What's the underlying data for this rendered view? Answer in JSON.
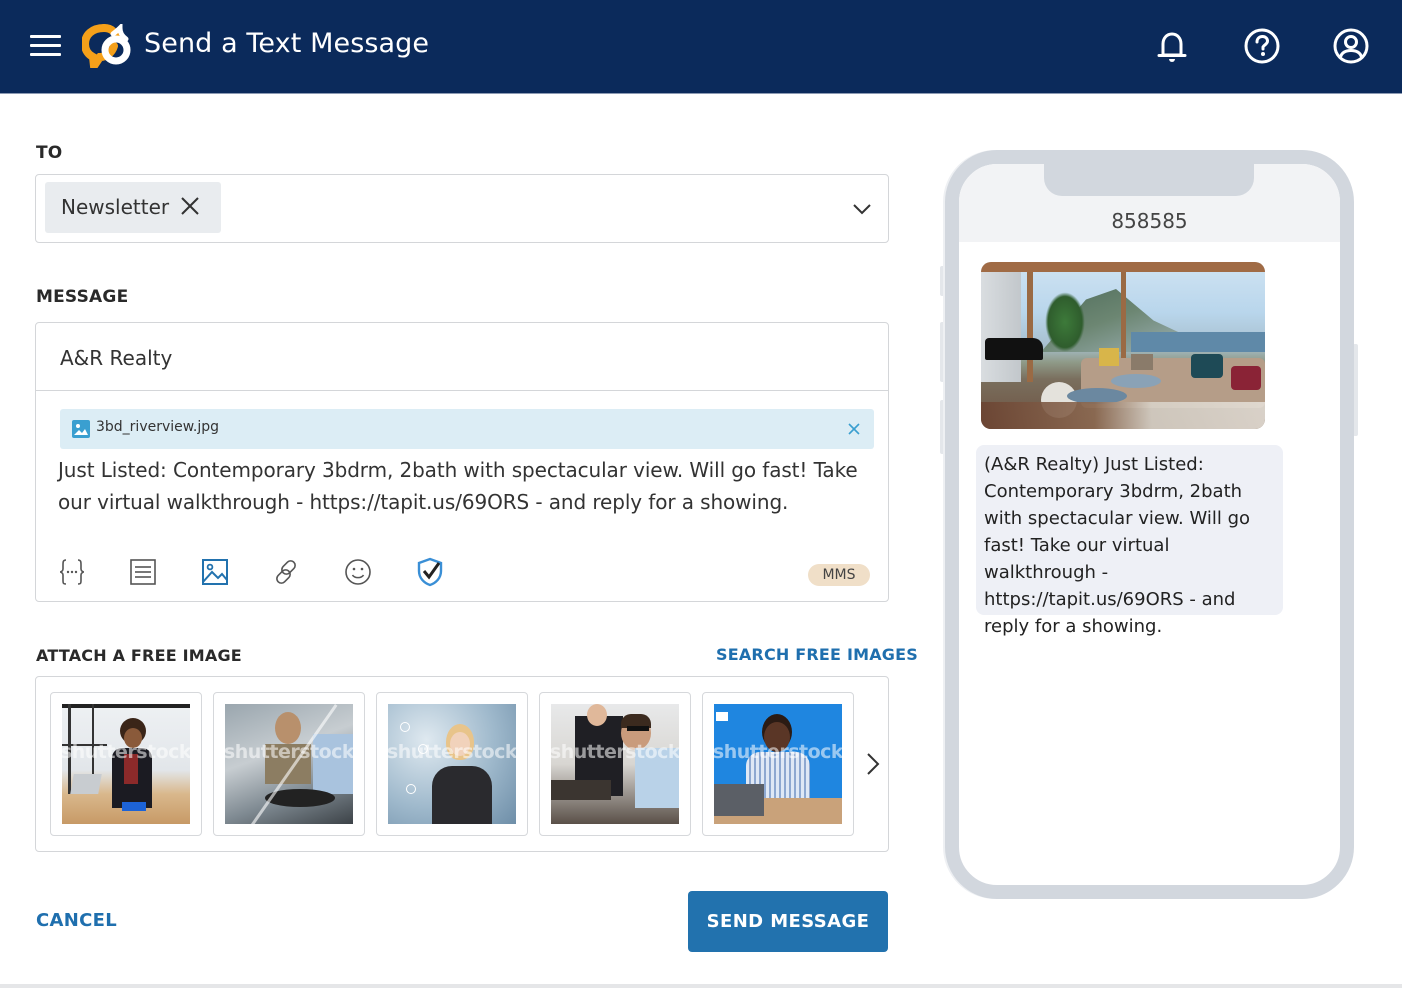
{
  "header": {
    "title": "Send a Text Message",
    "icons": [
      "menu-icon",
      "logo-icon",
      "bell-icon",
      "help-icon",
      "account-icon"
    ]
  },
  "to": {
    "label": "TO",
    "recipients": [
      {
        "label": "Newsletter"
      }
    ]
  },
  "message": {
    "label": "MESSAGE",
    "sender_name": "A&R Realty",
    "attachment": {
      "filename": "3bd_riverview.jpg"
    },
    "body": "Just Listed: Contemporary 3bdrm, 2bath with spectacular view. Will go fast! Take our virtual walkthrough - https://tapit.us/69ORS - and reply for a showing.",
    "toolbar": [
      "merge-field-icon",
      "template-icon",
      "image-icon",
      "link-icon",
      "emoji-icon",
      "compliance-shield-icon"
    ],
    "type_badge": "MMS"
  },
  "free_images": {
    "label": "ATTACH A FREE IMAGE",
    "search_label": "SEARCH FREE IMAGES",
    "watermark": "shutterstock",
    "thumbnails": [
      {
        "alt": "Woman waving at desk with laptop"
      },
      {
        "alt": "People handling a vinyl record player"
      },
      {
        "alt": "Woman with headset, network background"
      },
      {
        "alt": "Men adjusting a turntable"
      },
      {
        "alt": "Man with headset pointing up, blue background"
      }
    ]
  },
  "actions": {
    "cancel_label": "CANCEL",
    "send_label": "SEND MESSAGE"
  },
  "preview": {
    "short_code": "858585",
    "image_alt": "Living room with mountain lake view",
    "bubble_text": "(A&R Realty) Just Listed: Contemporary 3bdrm, 2bath with spectacular view. Will go fast! Take our virtual walkthrough - https://tapit.us/69ORS - and reply for a showing."
  },
  "colors": {
    "header_bg": "#0b2a5b",
    "accent": "#2272ae",
    "logo_orange": "#f5a01a",
    "attachment_bg": "#dcedf5",
    "mms_badge_bg": "#f0dfc8"
  }
}
